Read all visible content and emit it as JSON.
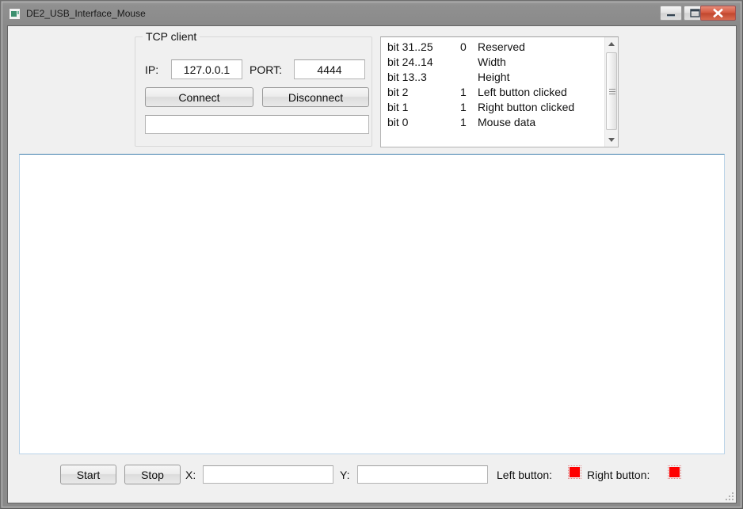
{
  "window": {
    "title": "DE2_USB_Interface_Mouse",
    "icon": "app-icon",
    "buttons": {
      "minimize": "minimize-icon",
      "maximize": "maximize-icon",
      "close": "close-icon"
    }
  },
  "tcp_group": {
    "legend": "TCP client",
    "ip_label": "IP:",
    "ip_value": "127.0.0.1",
    "port_label": "PORT:",
    "port_value": "4444",
    "connect_label": "Connect",
    "disconnect_label": "Disconnect",
    "status_value": "",
    "status_placeholder": ""
  },
  "bit_list": {
    "rows": [
      {
        "bit": "bit 31..25",
        "value": "0",
        "desc": "Reserved"
      },
      {
        "bit": "bit 24..14",
        "value": "",
        "desc": "Width"
      },
      {
        "bit": "bit 13..3",
        "value": "",
        "desc": "Height"
      },
      {
        "bit": "bit 2",
        "value": "1",
        "desc": "Left button clicked"
      },
      {
        "bit": "bit 1",
        "value": "1",
        "desc": "Right button clicked"
      },
      {
        "bit": "bit 0",
        "value": "1",
        "desc": "Mouse data"
      }
    ],
    "scrollbar": {
      "up": "scroll-up-icon",
      "down": "scroll-down-icon"
    }
  },
  "bottom_bar": {
    "start_label": "Start",
    "stop_label": "Stop",
    "x_label": "X:",
    "x_value": "",
    "y_label": "Y:",
    "y_value": "",
    "left_button_label": "Left button:",
    "right_button_label": "Right button:",
    "indicator_color": "#fe0000"
  }
}
